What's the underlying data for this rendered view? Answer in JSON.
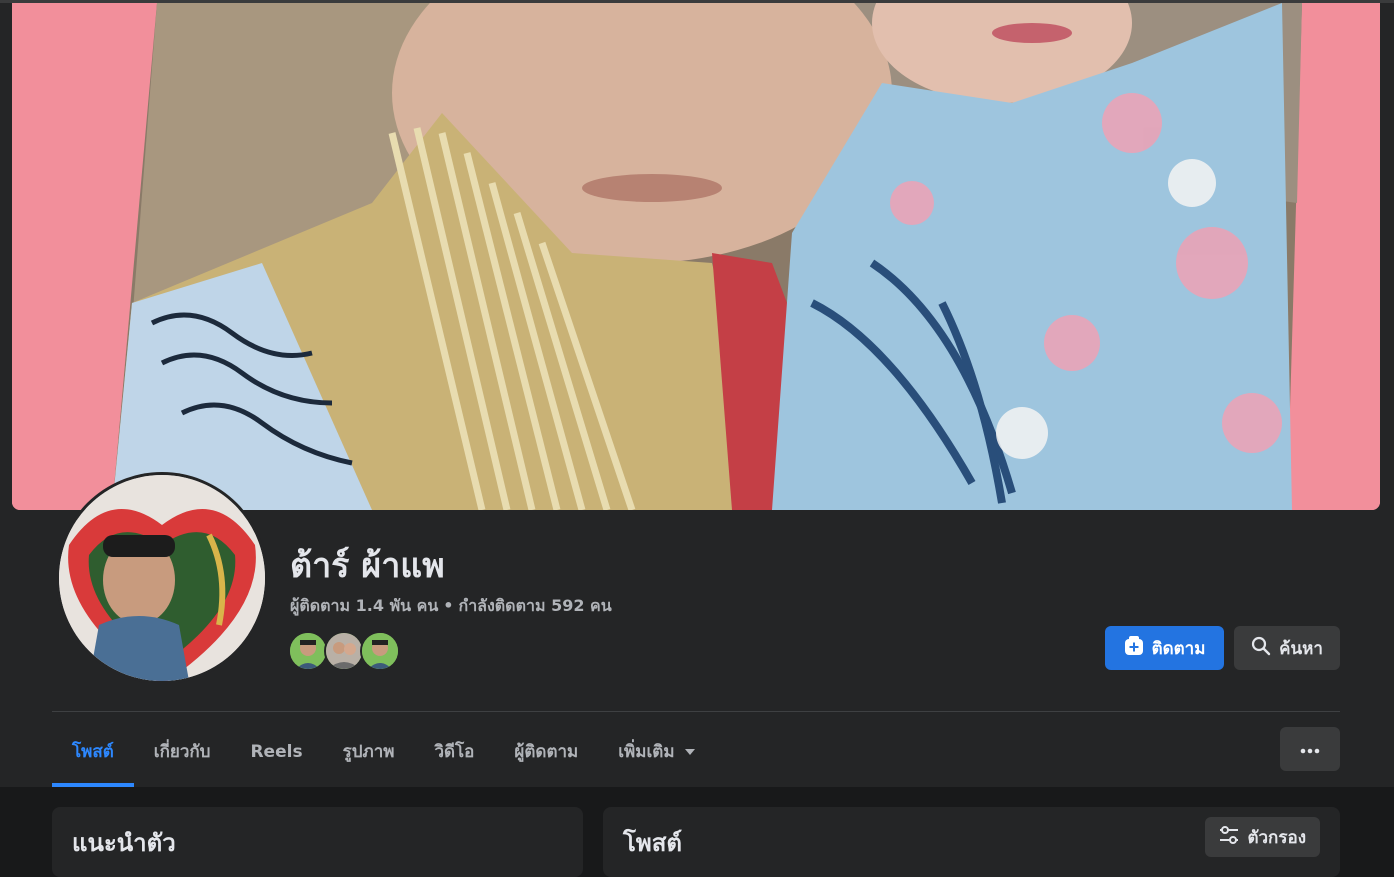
{
  "profile": {
    "name": "ต้าร์ ผ้าแพ",
    "followers_label": "ผู้ติดตาม 1.4 พัน คน",
    "separator": "•",
    "following_label": "กำลังติดตาม 592 คน"
  },
  "actions": {
    "follow_label": "ติดตาม",
    "search_label": "ค้นหา",
    "more_label": "..."
  },
  "tabs": [
    {
      "label": "โพสต์",
      "active": true
    },
    {
      "label": "เกี่ยวกับ",
      "active": false
    },
    {
      "label": "Reels",
      "active": false
    },
    {
      "label": "รูปภาพ",
      "active": false
    },
    {
      "label": "วิดีโอ",
      "active": false
    },
    {
      "label": "ผู้ติดตาม",
      "active": false
    },
    {
      "label": "เพิ่มเติม",
      "active": false
    }
  ],
  "intro_card": {
    "title": "แนะนำตัว"
  },
  "posts_card": {
    "title": "โพสต์",
    "filter_label": "ตัวกรอง"
  },
  "colors": {
    "accent": "#2374e1",
    "tab_active": "#2d88ff",
    "background": "#18191a",
    "surface": "#242526",
    "cover_border": "#f28f9b"
  }
}
